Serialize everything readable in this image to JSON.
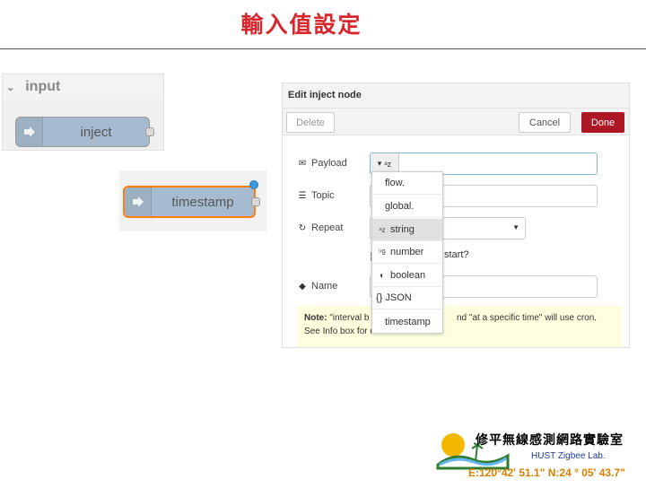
{
  "slide": {
    "title": "輸入值設定"
  },
  "palette": {
    "category": "input",
    "node_label": "inject",
    "node_color": "#a6bbcf"
  },
  "workspace_node": {
    "label": "timestamp",
    "border_color": "#ff7f0e",
    "status_dot_color": "#3a9ad9"
  },
  "dialog": {
    "title": "Edit inject node",
    "delete_label": "Delete",
    "cancel_label": "Cancel",
    "done_label": "Done",
    "payload_label": "Payload",
    "topic_label": "Topic",
    "repeat_label": "Repeat",
    "name_label": "Name",
    "payload_type_icon": "ᵃz",
    "start_fragment": "start?",
    "note": {
      "prefix": "Note:",
      "text1": "\"interval b",
      "text2": "nd \"at a specific time\" will use cron.",
      "text3": "See Info box for details."
    }
  },
  "dropdown": {
    "items": [
      {
        "icon": "",
        "label": "flow."
      },
      {
        "icon": "",
        "label": "global."
      },
      {
        "icon": "ᵃz",
        "label": "string"
      },
      {
        "icon": "⁰9",
        "label": "number"
      },
      {
        "icon": "◐",
        "label": "boolean"
      },
      {
        "icon": "",
        "label": "{} JSON"
      },
      {
        "icon": "",
        "label": "timestamp"
      }
    ],
    "active_index": 2
  },
  "lab": {
    "name": "修平無線感測網路實驗室",
    "english": "HUST Zigbee Lab.",
    "coordinates": "E:120°42' 51.1\"  N:24 ° 05' 43.7\""
  }
}
